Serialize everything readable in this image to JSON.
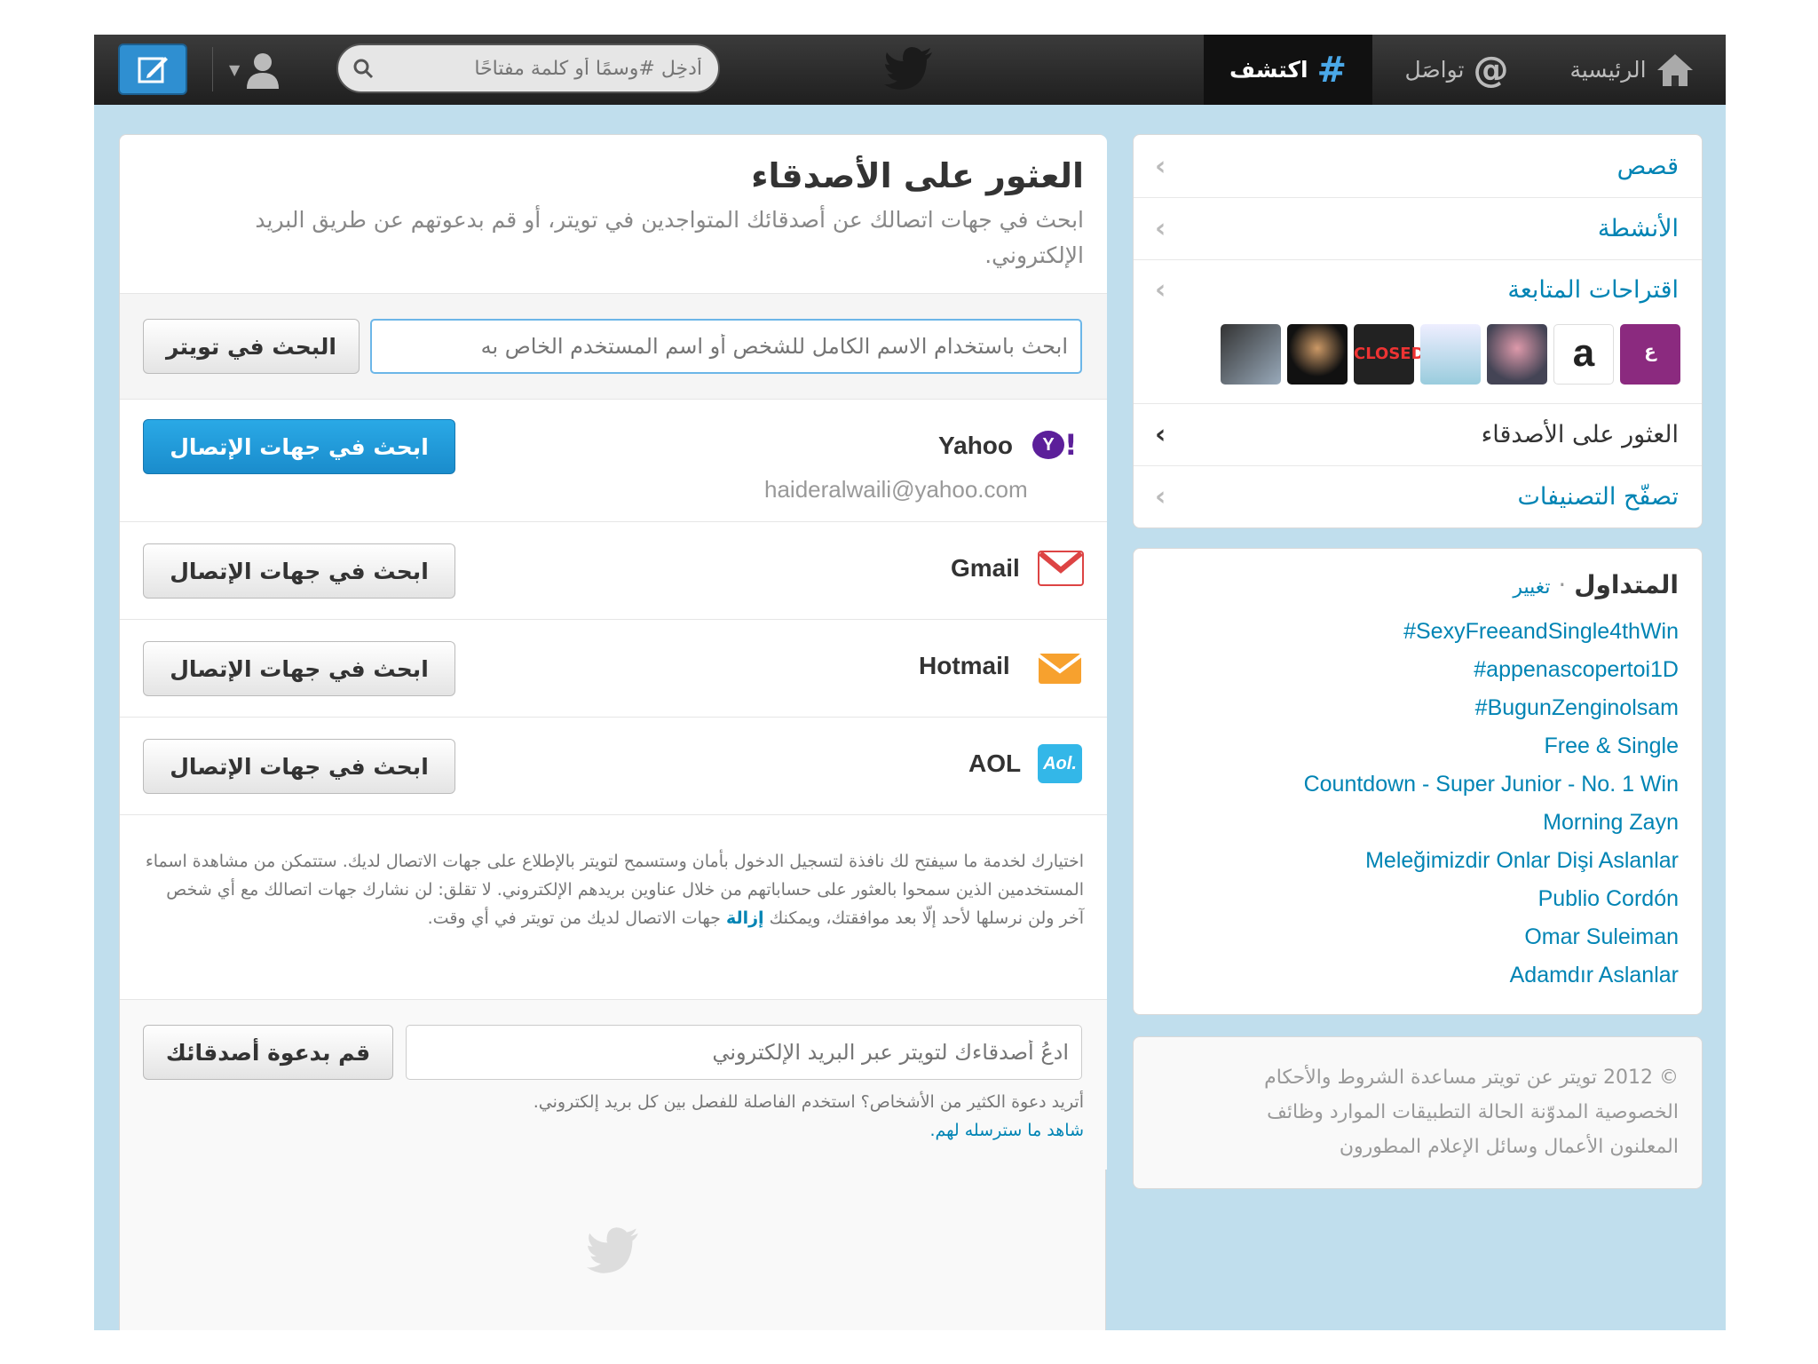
{
  "topbar": {
    "home_label": "الرئيسية",
    "connect_label": "تواصَل",
    "discover_label": "اكتشف",
    "search_placeholder": "أدخِل #وسمًا أو كلمة مفتاحًا"
  },
  "main": {
    "title": "العثور على الأصدقاء",
    "subtitle": "ابحث في جهات اتصالك عن أصدقائك المتواجدين في تويتر، أو قم بدعوتهم عن طريق البريد الإلكتروني.",
    "search_placeholder": "ابحث باستخدام الاسم الكامل للشخص أو اسم المستخدم الخاص به",
    "search_button": "البحث في تويتر",
    "services": [
      {
        "name": "Yahoo",
        "email": "haideralwaili@yahoo.com",
        "button": "ابحث في جهات الإتصال"
      },
      {
        "name": "Gmail",
        "button": "ابحث في جهات الإتصال"
      },
      {
        "name": "Hotmail",
        "button": "ابحث في جهات الإتصال"
      },
      {
        "name": "AOL",
        "button": "ابحث في جهات الإتصال"
      }
    ],
    "disclaimer": "اختيارك لخدمة ما سيفتح لك نافذة لتسجيل الدخول بأمان وستسمح لتويتر بالإطلاع على جهات الاتصال لديك. ستتمكن من مشاهدة اسماء المستخدمين الذين سمحوا بالعثور على حساباتهم من خلال عناوين بريدهم الإلكتروني. لا تقلق: لن نشارك جهات اتصالك مع أي شخص آخر ولن نرسلها لأحد إلّا بعد موافقتك، ويمكنك",
    "disclaimer_link": "إزالة",
    "disclaimer_tail": "جهات الاتصال لديك من تويتر في أي وقت.",
    "invite_placeholder": "ادعُ أصدقاءك لتويتر عبر البريد الإلكتروني",
    "invite_button": "قم بدعوة أصدقائك",
    "invite_hint": "أتريد دعوة الكثير من الأشخاص؟ استخدم الفاصلة للفصل بين كل بريد إلكتروني.",
    "invite_preview_link": "شاهد ما سترسله لهم."
  },
  "sidebar": {
    "items": [
      {
        "label": "قصص"
      },
      {
        "label": "الأنشطة"
      },
      {
        "label": "اقتراحات المتابعة"
      },
      {
        "label": "العثور على الأصدقاء"
      },
      {
        "label": "تصفّح التصنيفات"
      }
    ],
    "avatars": [
      "Al Arabiya",
      "amazon",
      "person",
      "logo",
      "CLOSED",
      "person2",
      "person3"
    ]
  },
  "trends": {
    "title": "المتداول",
    "change": "تغيير",
    "items": [
      "#SexyFreeandSingle4thWin",
      "#appenascopertoi1D",
      "#BugunZenginolsam",
      "Free & Single",
      "Countdown - Super Junior - No. 1 Win",
      "Morning Zayn",
      "Meleğimizdir Onlar Dişi Aslanlar",
      "Publio Cordón",
      "Omar Suleiman",
      "Adamdır Aslanlar"
    ]
  },
  "footer": {
    "line1": "© 2012 تويتر  عن تويتر  مساعدة  الشروط والأحكام",
    "line2": "الخصوصية  المدوّنة  الحالة  التطبيقات  الموارد  وظائف",
    "line3": "المعلنون  الأعمال  وسائل الإعلام  المطورون"
  },
  "colors": {
    "link": "#0084b4",
    "primary_button": "#1a8ccc",
    "topbar": "#2a2a2a",
    "background": "#c0deed"
  }
}
